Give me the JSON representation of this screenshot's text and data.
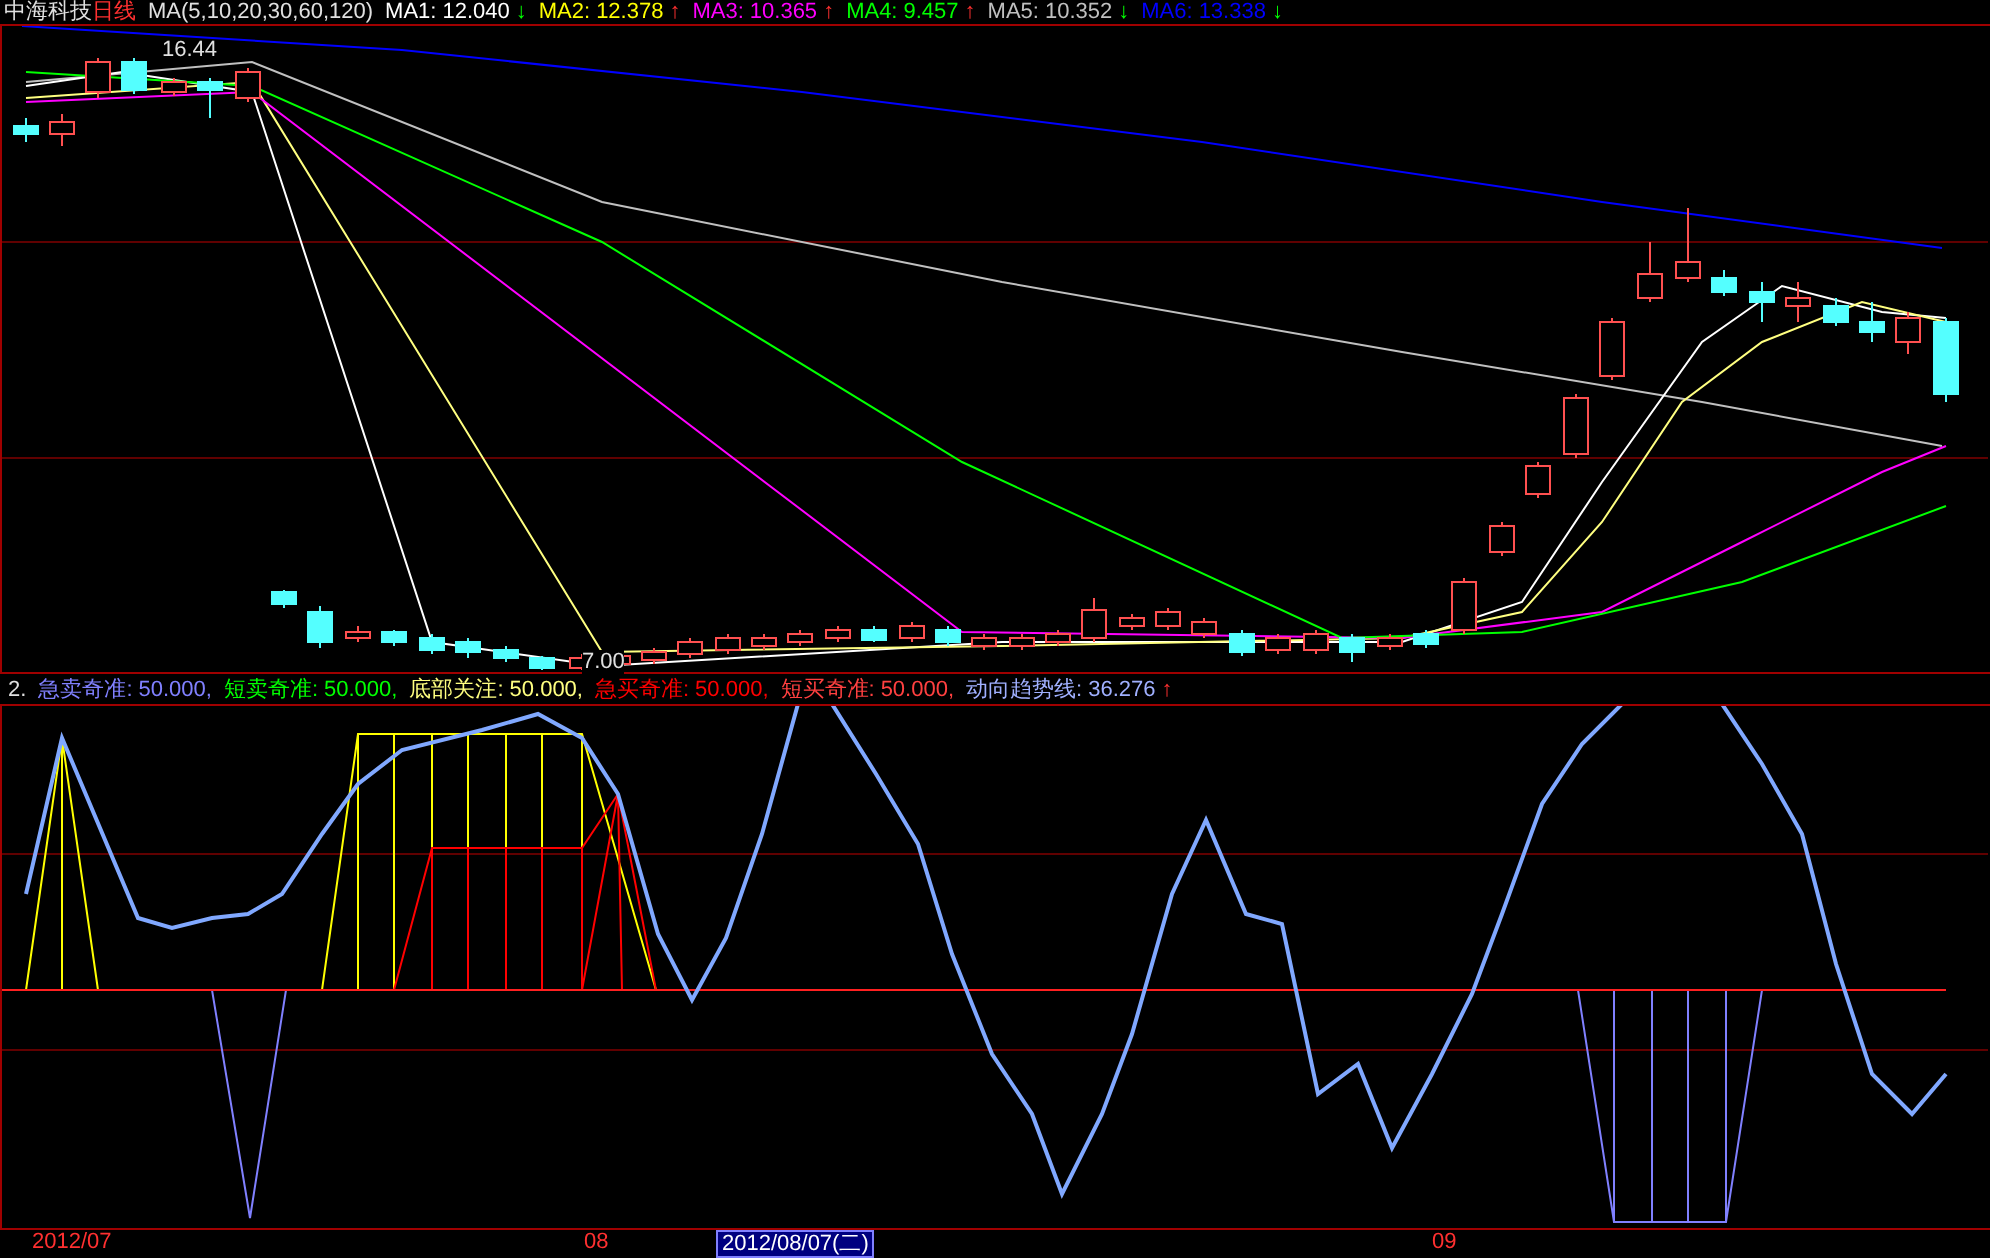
{
  "top_legend": {
    "stock_name": "中海科技",
    "period": "日线",
    "ma_params": "MA(5,10,20,30,60,120)",
    "items": [
      {
        "label": "MA1:",
        "value": "12.040",
        "arrow": "↓",
        "color": "#ffffff"
      },
      {
        "label": "MA2:",
        "value": "12.378",
        "arrow": "↑",
        "color": "#ffff00"
      },
      {
        "label": "MA3:",
        "value": "10.365",
        "arrow": "↑",
        "color": "#ff00ff"
      },
      {
        "label": "MA4:",
        "value": "9.457",
        "arrow": "↑",
        "color": "#00ff00"
      },
      {
        "label": "MA5:",
        "value": "10.352",
        "arrow": "↓",
        "color": "#c0c0c0"
      },
      {
        "label": "MA6:",
        "value": "13.338",
        "arrow": "↓",
        "color": "#0000ff"
      }
    ]
  },
  "price_chart": {
    "high_label": "16.44",
    "low_label": "7.00"
  },
  "indicator_legend": {
    "index": "2.",
    "items": [
      {
        "label": "急卖奇准:",
        "value": "50.000,",
        "color": "#8080ff"
      },
      {
        "label": "短卖奇准:",
        "value": "50.000,",
        "color": "#00ff00"
      },
      {
        "label": "底部关注:",
        "value": "50.000,",
        "color": "#ffff80"
      },
      {
        "label": "急买奇准:",
        "value": "50.000,",
        "color": "#ff0000"
      },
      {
        "label": "短买奇准:",
        "value": "50.000,",
        "color": "#ff4040"
      },
      {
        "label": "动向趋势线:",
        "value": "36.276",
        "arrow": "↑",
        "color": "#a0b0ff"
      }
    ]
  },
  "time_axis": [
    {
      "label": "2012/07",
      "selected": false
    },
    {
      "label": "08",
      "selected": false
    },
    {
      "label": "2012/08/07(二)",
      "selected": true
    },
    {
      "label": "09",
      "selected": false
    }
  ]
}
